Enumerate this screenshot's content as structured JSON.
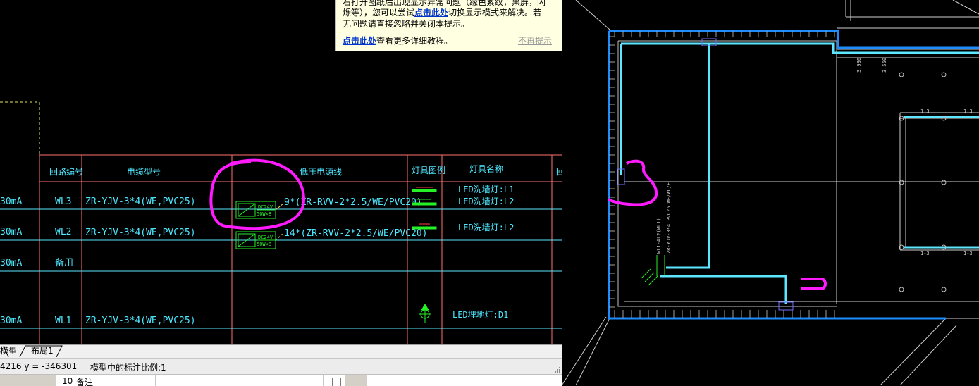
{
  "tip": {
    "line1": "右打开图纸后出现显示异常问题（缘色紊纹，黑屏，闪",
    "line2": "烁等），您可以尝试",
    "line2_link": "点击此处",
    "line2_tail": "切换显示模式来解决。若",
    "line3": "无问题请直接忽略并关闭本提示。",
    "line4_link": "点击此处",
    "line4_tail": "查看更多详细教程。",
    "dismiss": "不再提示"
  },
  "table": {
    "headers": {
      "circuit": "回路编号",
      "cable": "电缆型号",
      "low_voltage": "低压电源线",
      "lamp_symbol": "灯具图例",
      "lamp_name": "灯具名称",
      "extra": "回"
    },
    "rows": [
      {
        "leak": "30mA",
        "circuit": "WL3",
        "cable": "ZR-YJV-3*4(WE,PVC25)",
        "lv": "9*(ZR-RVV-2*2.5/WE/PVC20)",
        "lamp_names": [
          "LED洗墙灯:L1",
          "LED洗墙灯:L2"
        ],
        "box": [
          "DC24V",
          "50W×8"
        ]
      },
      {
        "leak": "30mA",
        "circuit": "WL2",
        "cable": "ZR-YJV-3*4(WE,PVC25)",
        "lv": "14*(ZR-RVV-2*2.5/WE/PVC20)",
        "lamp_names": [
          "LED洗墙灯:L2"
        ],
        "box": [
          "DC24V",
          "50W×8"
        ]
      },
      {
        "leak": "30mA",
        "circuit": "备用",
        "cable": "",
        "lv": "",
        "lamp_names": [],
        "box": []
      },
      {
        "leak": "30mA",
        "circuit": "WL1",
        "cable": "ZR-YJV-3*4(WE,PVC25)",
        "lv": "",
        "lamp_names": [
          "LED埋地灯:D1"
        ],
        "box": []
      }
    ]
  },
  "plan_labels": {
    "dim1": "3.930",
    "dim2": "3.550",
    "section_marks": [
      "1-3",
      "1-3",
      "1-3",
      "1-3"
    ],
    "wire1": "WL1-AL2(WL1)",
    "wire2": "ZR-YJV-3*4 PVC25 WE/WC/FC"
  },
  "tabs": {
    "model": "模型",
    "layout1": "布局1"
  },
  "status": {
    "coords": "4216 y = -346301",
    "scale": "模型中的标注比例:1"
  },
  "props": {
    "row_num": "10",
    "row_label": "备注"
  },
  "colors": {
    "table_line": "#ff6f6f",
    "cyan_line": "#5ce6ff",
    "table_text": "#4ee8ff",
    "green": "#26f026",
    "magenta": "#ff1aff",
    "wall_blue": "#1c8cff",
    "tip_bg": "#ffffe1",
    "link": "#0033cc"
  }
}
